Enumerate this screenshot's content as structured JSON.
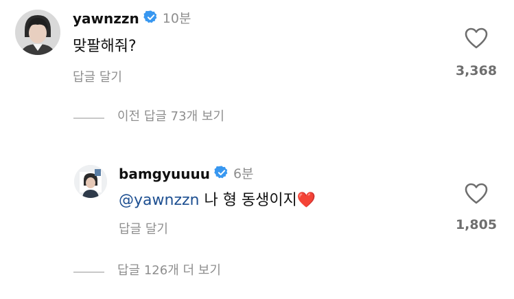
{
  "comment": {
    "username": "yawnzzn",
    "time": "10분",
    "text": "맞팔해줘?",
    "reply_label": "답글 달기",
    "like_count": "3,368",
    "avatar_icon": "person-avatar",
    "verified_icon": "verified-badge-icon"
  },
  "previous_replies_label": "이전 답글 73개 보기",
  "reply": {
    "username": "bamgyuuuu",
    "time": "6분",
    "mention": "@yawnzzn",
    "text": " 나 형 동생이지",
    "emoji": "❤️",
    "reply_label": "답글 달기",
    "like_count": "1,805",
    "avatar_icon": "person-avatar",
    "verified_icon": "verified-badge-icon"
  },
  "more_replies_label": "답글 126개 더 보기",
  "colors": {
    "verified": "#3897f0",
    "mention": "#1d4f91",
    "muted": "#8e8e8e"
  }
}
